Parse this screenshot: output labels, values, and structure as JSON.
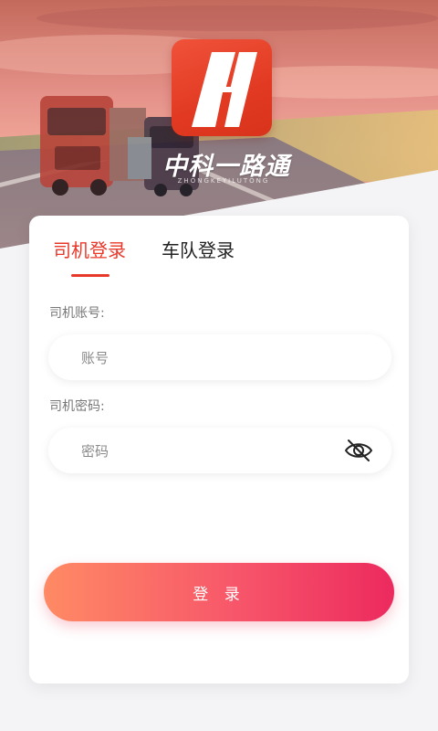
{
  "app": {
    "brand_name": "中科一路通",
    "brand_subtitle": "ZHONGKEYILUTONG",
    "accent_color": "#e8382a"
  },
  "tabs": [
    {
      "label": "司机登录",
      "active": true
    },
    {
      "label": "车队登录",
      "active": false
    }
  ],
  "form": {
    "account_label": "司机账号:",
    "account_placeholder": "账号",
    "password_label": "司机密码:",
    "password_placeholder": "密码",
    "password_toggle_icon": "eye-off-icon"
  },
  "login_button": {
    "label": "登 录",
    "gradient": [
      "#ff8a64",
      "#ec2a5e"
    ]
  }
}
